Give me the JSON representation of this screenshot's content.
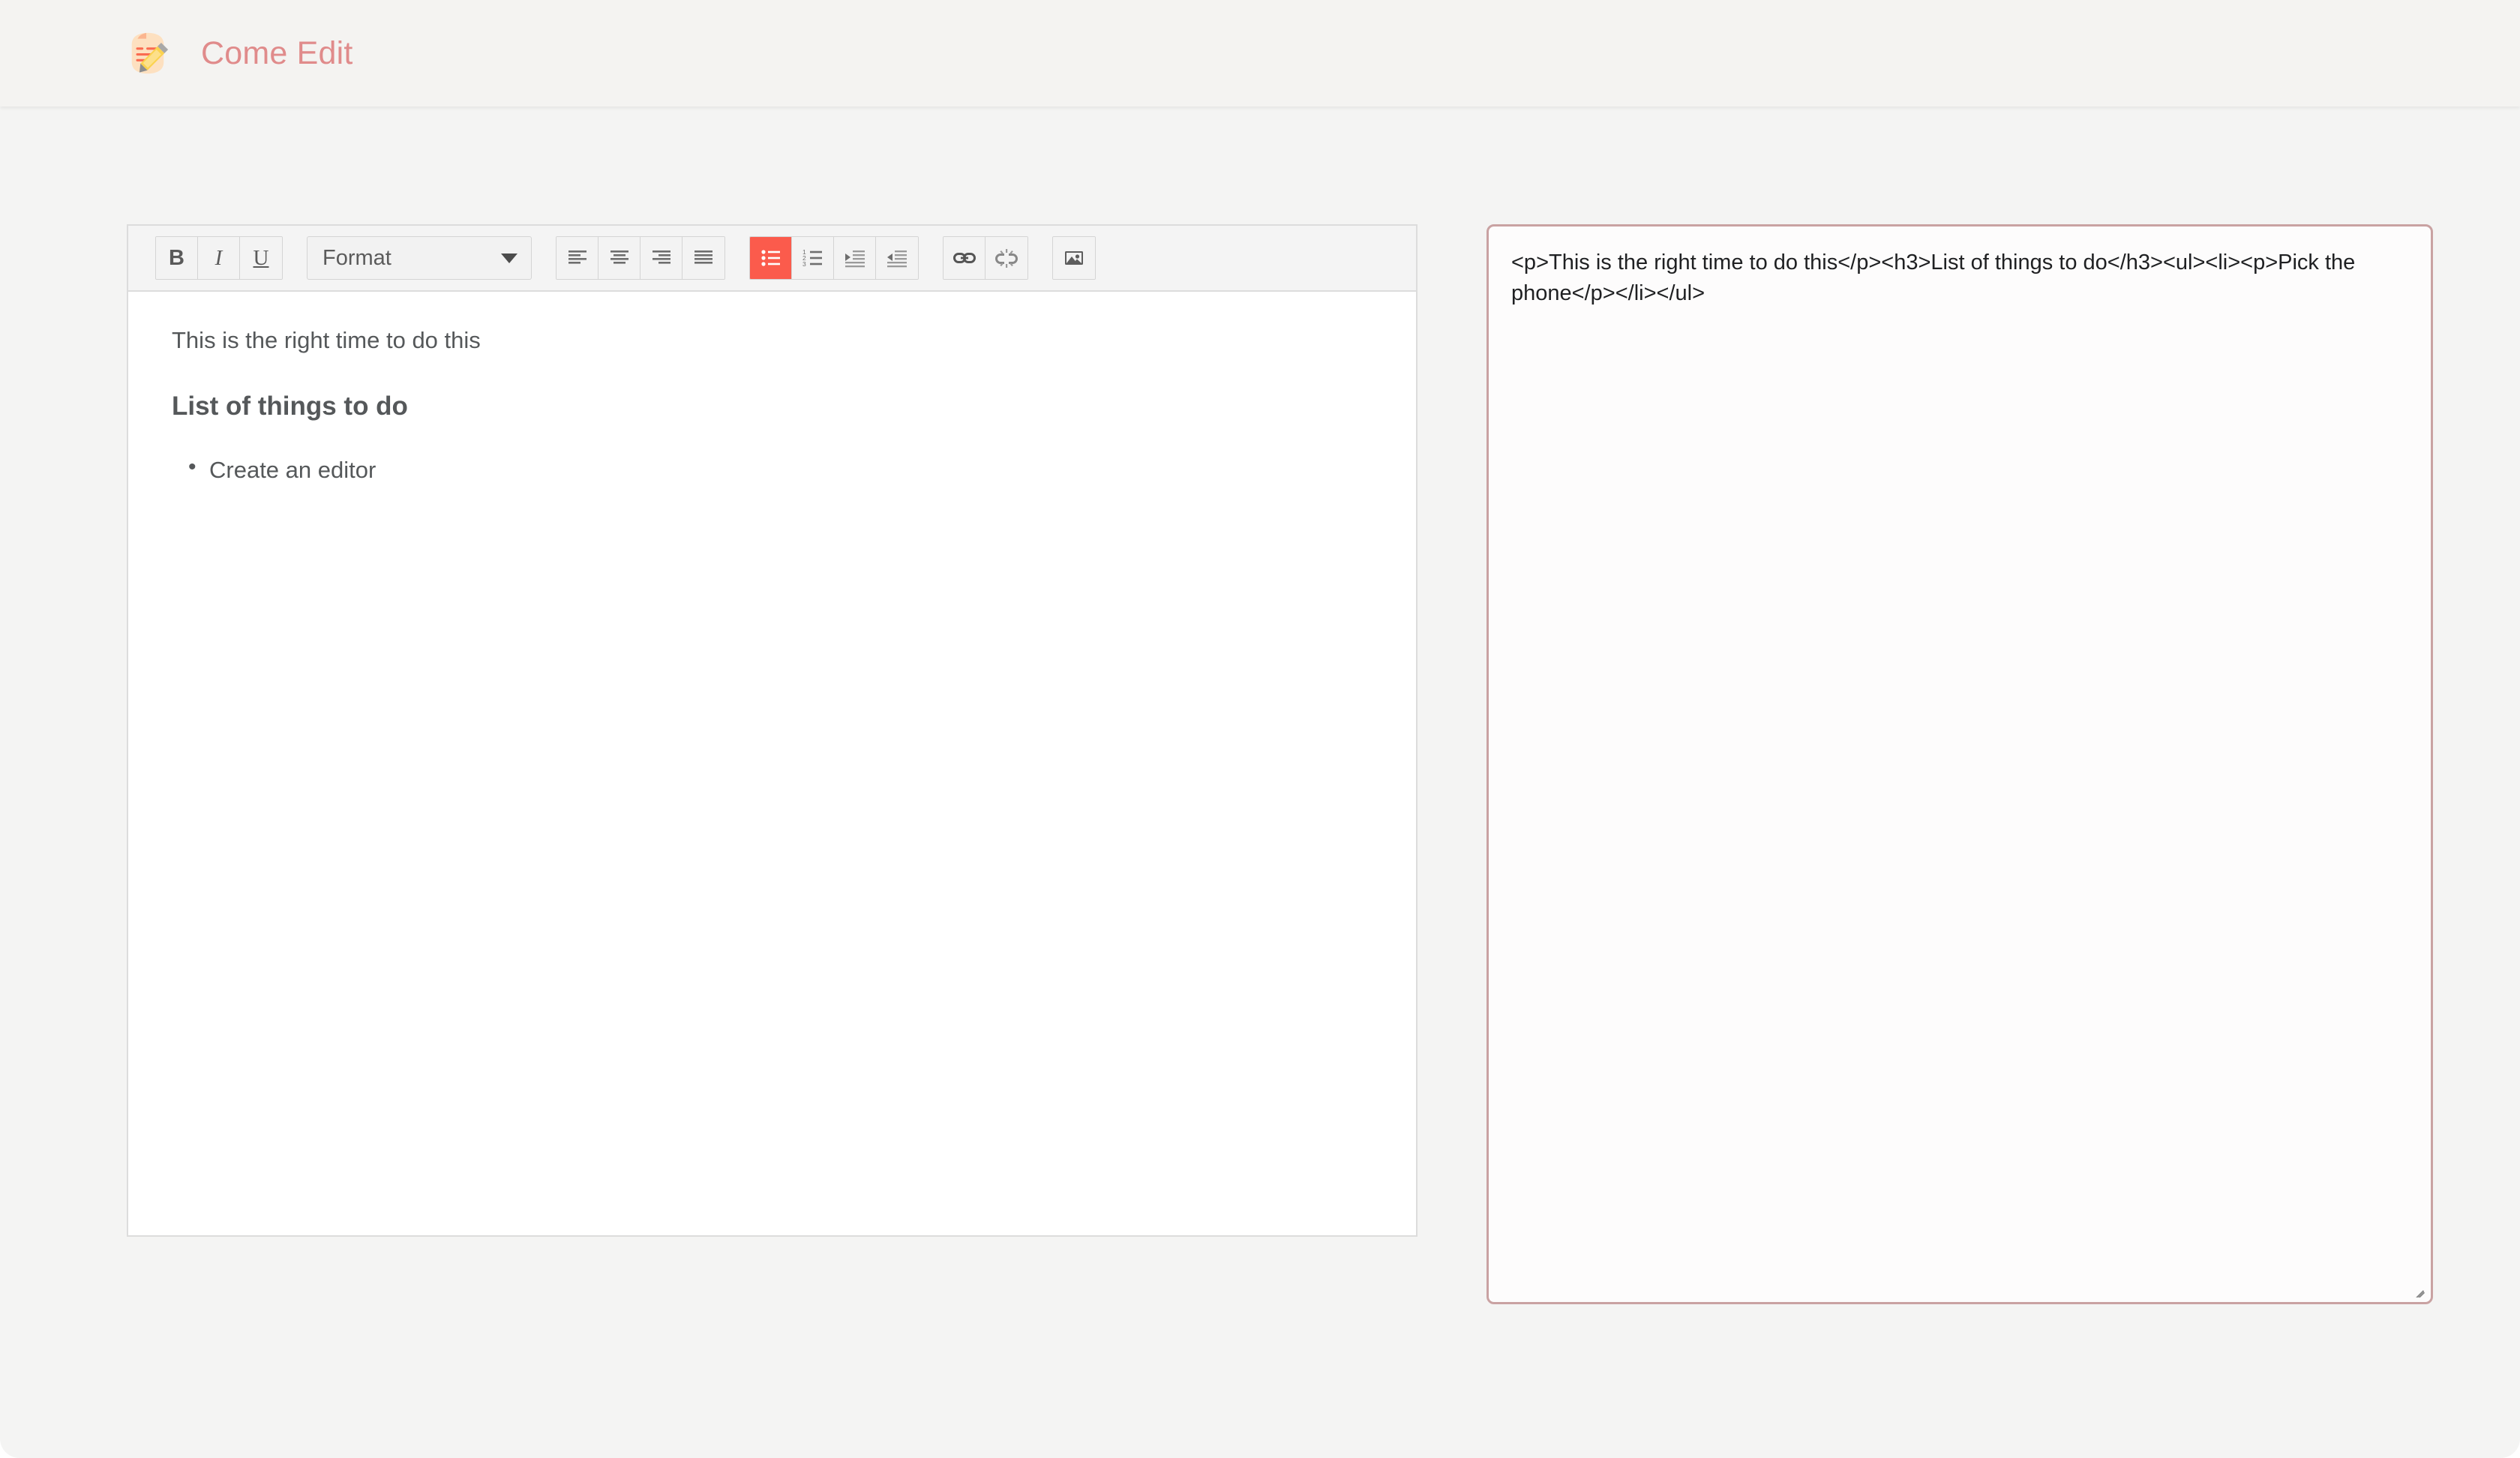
{
  "header": {
    "logo_icon": "document-pencil-icon",
    "title": "Come Edit",
    "title_color": "#e08b8b",
    "background_color": "#f4f3f1"
  },
  "theme": {
    "page_background": "#f4f4f3",
    "accent_active": "#fb5b4c",
    "panel_border": "#dcdcdc",
    "textarea_border": "#c9a2a2",
    "text_color": "#55585a"
  },
  "editor": {
    "toolbar": {
      "text_style_group": [
        {
          "name": "bold-button",
          "label": "B",
          "icon": "bold-icon",
          "active": false
        },
        {
          "name": "italic-button",
          "label": "I",
          "icon": "italic-icon",
          "active": false
        },
        {
          "name": "underline-button",
          "label": "U",
          "icon": "underline-icon",
          "active": false
        }
      ],
      "format_select": {
        "label": "Format",
        "icon": "chevron-down-icon"
      },
      "align_group": [
        {
          "name": "align-left-button",
          "icon": "align-left-icon",
          "active": false
        },
        {
          "name": "align-center-button",
          "icon": "align-center-icon",
          "active": false
        },
        {
          "name": "align-right-button",
          "icon": "align-right-icon",
          "active": false
        },
        {
          "name": "align-justify-button",
          "icon": "align-justify-icon",
          "active": false
        }
      ],
      "list_group": [
        {
          "name": "bullet-list-button",
          "icon": "bullet-list-icon",
          "active": true
        },
        {
          "name": "numbered-list-button",
          "icon": "numbered-list-icon",
          "active": false
        },
        {
          "name": "indent-button",
          "icon": "indent-icon",
          "active": false
        },
        {
          "name": "outdent-button",
          "icon": "outdent-icon",
          "active": false
        }
      ],
      "link_group": [
        {
          "name": "insert-link-button",
          "icon": "link-icon",
          "active": false
        },
        {
          "name": "unlink-button",
          "icon": "unlink-icon",
          "active": false
        }
      ],
      "media_group": [
        {
          "name": "insert-image-button",
          "icon": "image-icon",
          "active": false
        }
      ]
    },
    "content": {
      "paragraph": "This is the right time to do this",
      "heading": "List of things to do",
      "list_items": [
        "Create an editor"
      ]
    }
  },
  "source": {
    "value": "<p>This is the right time to do this</p><h3>List of things to do</h3><ul><li><p>Pick the phone</p></li></ul>",
    "placeholder": ""
  }
}
